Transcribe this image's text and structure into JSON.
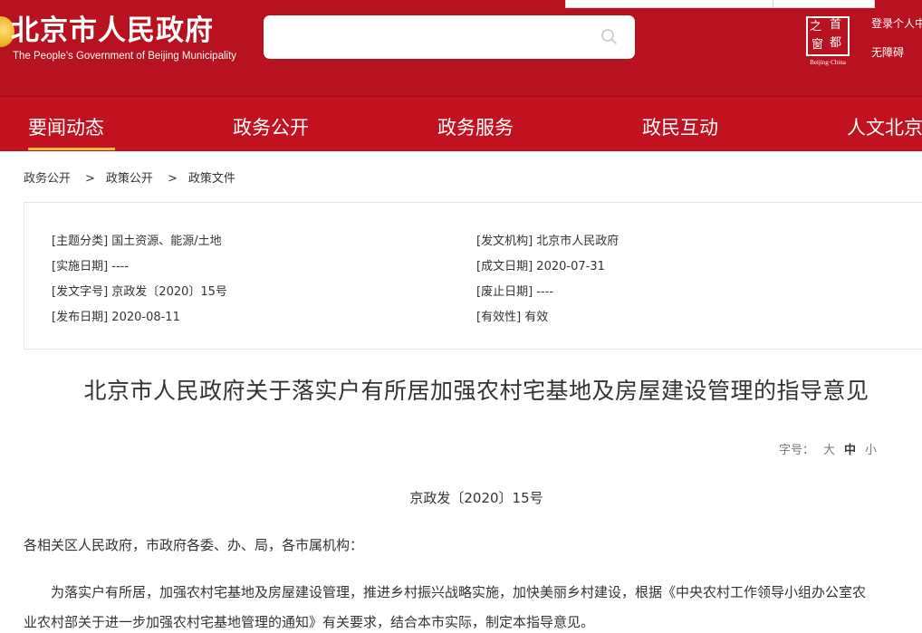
{
  "header": {
    "logo_cn": "北京市人民政府",
    "logo_en": "The People's Government of Beijing Municipality",
    "search_placeholder": "",
    "capital_logo": {
      "chars": [
        "之",
        "首",
        "窗",
        "都"
      ],
      "en": "Beijing·China"
    },
    "login_link": "登录个人中",
    "accessibility_link": "无障碍"
  },
  "nav": {
    "items": [
      "要闻动态",
      "政务公开",
      "政务服务",
      "政民互动",
      "人文北京"
    ],
    "active_index": 0
  },
  "breadcrumb": {
    "items": [
      "政务公开",
      "政策公开",
      "政策文件"
    ],
    "separator": ">"
  },
  "info": {
    "left": [
      {
        "label": "[主题分类]",
        "value": "国土资源、能源/土地"
      },
      {
        "label": "[实施日期]",
        "value": "----"
      },
      {
        "label": "[发文字号]",
        "value": "京政发〔2020〕15号"
      },
      {
        "label": "[发布日期]",
        "value": "2020-08-11"
      }
    ],
    "right": [
      {
        "label": "[发文机构]",
        "value": "北京市人民政府"
      },
      {
        "label": "[成文日期]",
        "value": "2020-07-31"
      },
      {
        "label": "[废止日期]",
        "value": "----"
      },
      {
        "label": "[有效性]",
        "value": "有效"
      }
    ]
  },
  "article": {
    "title": "北京市人民政府关于落实户有所居加强农村宅基地及房屋建设管理的指导意见",
    "font_size": {
      "label": "字号：",
      "options": [
        "大",
        "中",
        "小"
      ],
      "selected": "中"
    },
    "doc_number": "京政发〔2020〕15号",
    "salutation": "各相关区人民政府，市政府各委、办、局，各市属机构：",
    "paragraph_lines": [
      "为落实户有所居，加强农村宅基地及房屋建设管理，推进乡村振兴战略实施，加快美丽乡村建设，根据《中央农村工作领导小组办公室农",
      "业农村部关于进一步加强农村宅基地管理的通知》有关要求，结合本市实际，制定本指导意见。"
    ]
  },
  "colors": {
    "header_red": "#b8111f",
    "nav_red": "#c2121f",
    "active_underline": "#f4b83a"
  },
  "icons": {
    "search": "search-icon",
    "emblem": "national-emblem-icon",
    "capital_logo": "capital-window-logo"
  }
}
